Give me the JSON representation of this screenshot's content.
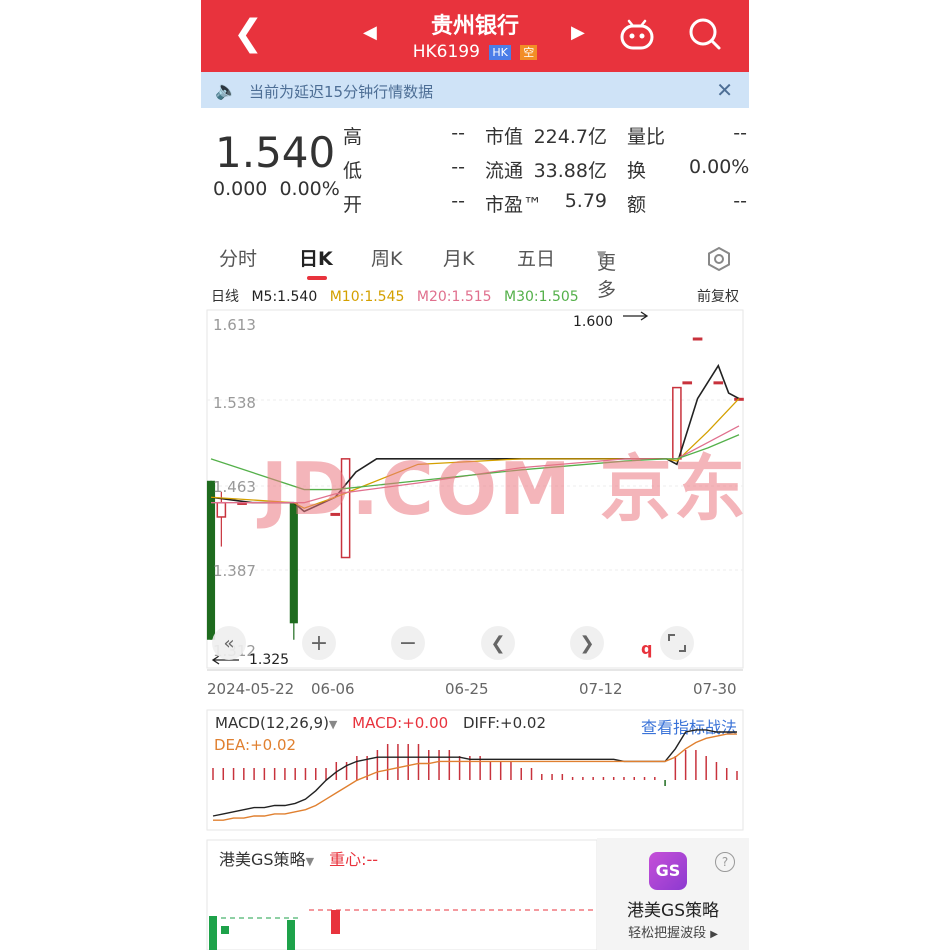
{
  "header": {
    "stock_name": "贵州银行",
    "stock_code": "HK6199",
    "market_tag": "HK",
    "short_tag": "空"
  },
  "notice": {
    "text": "当前为延迟15分钟行情数据"
  },
  "quote": {
    "price": "1.540",
    "change": "0.000",
    "change_pct": "0.00%",
    "high_label": "高",
    "high": "--",
    "low_label": "低",
    "low": "--",
    "open_label": "开",
    "open": "--",
    "mktcap_label": "市值",
    "mktcap": "224.7亿",
    "float_label": "流通",
    "float": "33.88亿",
    "pe_label": "市盈™",
    "pe": "5.79",
    "vol_ratio_label": "量比",
    "vol_ratio": "--",
    "turnover_label": "换",
    "turnover": "0.00%",
    "amount_label": "额",
    "amount": "--"
  },
  "tabs": [
    "分时",
    "日K",
    "周K",
    "月K",
    "五日",
    "更多"
  ],
  "watermark": "JD.COM 京东",
  "colors": {
    "brand_red": "#e8333d",
    "up": "#c8323c",
    "down": "#1e6b1e",
    "ma5": "#222222",
    "ma10": "#d4a000",
    "ma20": "#e0708e",
    "ma30": "#54b04a"
  },
  "chart_data": {
    "type": "candlestick",
    "ma_legend": [
      {
        "label": "日线"
      },
      {
        "label": "M5:1.540"
      },
      {
        "label": "M10:1.545"
      },
      {
        "label": "M20:1.515"
      },
      {
        "label": "M30:1.505"
      }
    ],
    "adjust_mode": "前复权",
    "yticks": [
      "1.613",
      "1.538",
      "1.463",
      "1.387",
      "1.312"
    ],
    "ylim": [
      1.312,
      1.613
    ],
    "xticks": [
      "2024-05-22",
      "06-06",
      "06-25",
      "07-12",
      "07-30"
    ],
    "max_marker": "1.600",
    "min_marker": "1.325",
    "q_marker": "q",
    "candles": [
      {
        "i": 0,
        "o": 1.47,
        "c": 1.325,
        "h": 1.47,
        "l": 1.325
      },
      {
        "i": 1,
        "o": 1.437,
        "c": 1.45,
        "h": 1.46,
        "l": 1.41
      },
      {
        "i": 3,
        "o": 1.45,
        "c": 1.45,
        "h": 1.45,
        "l": 1.45
      },
      {
        "i": 8,
        "o": 1.45,
        "c": 1.34,
        "h": 1.45,
        "l": 1.325
      },
      {
        "i": 12,
        "o": 1.44,
        "c": 1.44,
        "h": 1.44,
        "l": 1.44
      },
      {
        "i": 13,
        "o": 1.4,
        "c": 1.49,
        "h": 1.49,
        "l": 1.4
      },
      {
        "i": 45,
        "o": 1.49,
        "c": 1.555,
        "h": 1.555,
        "l": 1.49
      },
      {
        "i": 46,
        "o": 1.56,
        "c": 1.56,
        "h": 1.56,
        "l": 1.56
      },
      {
        "i": 47,
        "o": 1.6,
        "c": 1.6,
        "h": 1.6,
        "l": 1.6
      },
      {
        "i": 49,
        "o": 1.56,
        "c": 1.56,
        "h": 1.56,
        "l": 1.56
      },
      {
        "i": 51,
        "o": 1.545,
        "c": 1.545,
        "h": 1.545,
        "l": 1.545
      }
    ],
    "series": [
      {
        "name": "M5",
        "x": [
          0,
          4,
          8,
          9,
          12,
          14,
          16,
          20,
          30,
          40,
          44,
          45,
          47,
          49,
          50,
          51
        ],
        "y": [
          1.455,
          1.45,
          1.45,
          1.442,
          1.455,
          1.478,
          1.49,
          1.49,
          1.49,
          1.49,
          1.49,
          1.485,
          1.545,
          1.575,
          1.55,
          1.545
        ]
      },
      {
        "name": "M10",
        "x": [
          0,
          8,
          9,
          12,
          20,
          30,
          40,
          44,
          45,
          48,
          51
        ],
        "y": [
          1.455,
          1.45,
          1.445,
          1.455,
          1.485,
          1.49,
          1.49,
          1.49,
          1.488,
          1.515,
          1.545
        ]
      },
      {
        "name": "M20",
        "x": [
          0,
          9,
          12,
          20,
          30,
          40,
          44,
          45,
          48,
          51
        ],
        "y": [
          1.45,
          1.45,
          1.458,
          1.468,
          1.482,
          1.49,
          1.49,
          1.49,
          1.505,
          1.52
        ]
      },
      {
        "name": "M30",
        "x": [
          0,
          9,
          12,
          20,
          30,
          40,
          44,
          45,
          48,
          51
        ],
        "y": [
          1.49,
          1.462,
          1.462,
          1.47,
          1.48,
          1.488,
          1.49,
          1.49,
          1.5,
          1.512
        ]
      }
    ],
    "n_bars": 52
  },
  "macd": {
    "name": "MACD(12,26,9)",
    "macd_label": "MACD:+0.00",
    "diff_label": "DIFF:+0.02",
    "dea_label": "DEA:+0.02",
    "link": "查看指标战法",
    "hist": [
      2,
      2,
      2,
      2,
      2,
      2,
      2,
      2,
      2,
      2,
      2,
      2,
      3,
      3,
      4,
      4,
      5,
      6,
      6,
      6,
      6,
      5,
      5,
      5,
      4,
      4,
      4,
      3,
      3,
      3,
      2,
      2,
      1,
      1,
      1,
      0.5,
      0.5,
      0.5,
      0.5,
      0.5,
      0.5,
      0.5,
      0.5,
      0.5,
      -1,
      4,
      5,
      5,
      4,
      3,
      2,
      1.5
    ],
    "diff": [
      -0.02,
      -0.019,
      -0.018,
      -0.017,
      -0.016,
      -0.016,
      -0.015,
      -0.015,
      -0.014,
      -0.012,
      -0.008,
      -0.003,
      0.001,
      0.004,
      0.006,
      0.007,
      0.008,
      0.008,
      0.008,
      0.008,
      0.008,
      0.008,
      0.008,
      0.008,
      0.008,
      0.007,
      0.007,
      0.007,
      0.007,
      0.007,
      0.007,
      0.007,
      0.007,
      0.007,
      0.007,
      0.007,
      0.007,
      0.007,
      0.007,
      0.007,
      0.006,
      0.006,
      0.006,
      0.006,
      0.006,
      0.012,
      0.02,
      0.021,
      0.021,
      0.02,
      0.02,
      0.02
    ],
    "dea": [
      -0.022,
      -0.022,
      -0.021,
      -0.021,
      -0.02,
      -0.02,
      -0.019,
      -0.019,
      -0.018,
      -0.017,
      -0.015,
      -0.012,
      -0.009,
      -0.006,
      -0.003,
      -0.001,
      0.001,
      0.002,
      0.003,
      0.004,
      0.005,
      0.005,
      0.006,
      0.006,
      0.006,
      0.006,
      0.006,
      0.006,
      0.006,
      0.006,
      0.006,
      0.006,
      0.006,
      0.006,
      0.006,
      0.006,
      0.006,
      0.006,
      0.006,
      0.006,
      0.006,
      0.006,
      0.006,
      0.006,
      0.006,
      0.008,
      0.012,
      0.015,
      0.017,
      0.018,
      0.019,
      0.019
    ]
  },
  "gs": {
    "name": "港美GS策略",
    "center_label": "重心:--",
    "logo": "GS",
    "promo_title": "港美GS策略",
    "promo_subtitle": "轻松把握波段"
  }
}
